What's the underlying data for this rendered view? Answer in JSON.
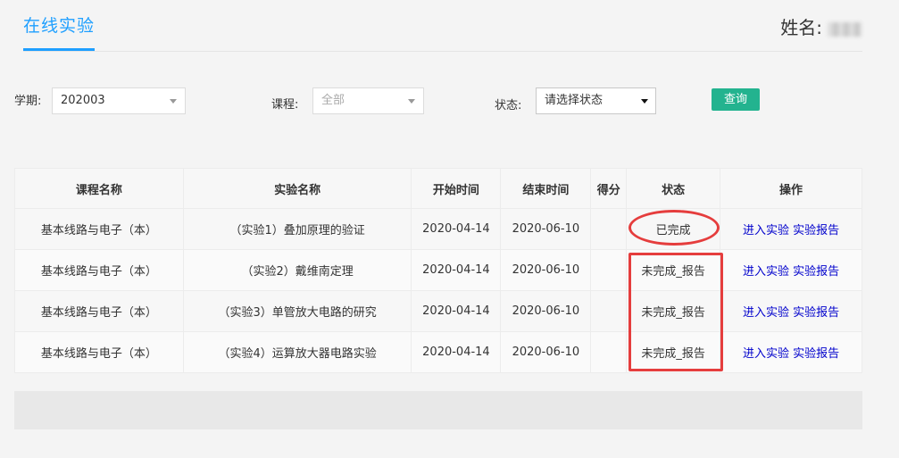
{
  "header": {
    "tab_label": "在线实验",
    "user_label": "姓名:"
  },
  "filters": {
    "term_label": "学期:",
    "term_value": "202003",
    "course_label": "课程:",
    "course_value": "全部",
    "status_label": "状态:",
    "status_value": "请选择状态",
    "query_button": "查询"
  },
  "table": {
    "headers": [
      "课程名称",
      "实验名称",
      "开始时间",
      "结束时间",
      "得分",
      "状态",
      "操作"
    ],
    "rows": [
      {
        "course": "基本线路与电子（本）",
        "experiment": "（实验1）叠加原理的验证",
        "start": "2020-04-14",
        "end": "2020-06-10",
        "score": "",
        "status": "已完成",
        "action_enter": "进入实验",
        "action_report": "实验报告"
      },
      {
        "course": "基本线路与电子（本）",
        "experiment": "（实验2）戴维南定理",
        "start": "2020-04-14",
        "end": "2020-06-10",
        "score": "",
        "status": "未完成_报告",
        "action_enter": "进入实验",
        "action_report": "实验报告"
      },
      {
        "course": "基本线路与电子（本）",
        "experiment": "（实验3）单管放大电路的研究",
        "start": "2020-04-14",
        "end": "2020-06-10",
        "score": "",
        "status": "未完成_报告",
        "action_enter": "进入实验",
        "action_report": "实验报告"
      },
      {
        "course": "基本线路与电子（本）",
        "experiment": "（实验4）运算放大器电路实验",
        "start": "2020-04-14",
        "end": "2020-06-10",
        "score": "",
        "status": "未完成_报告",
        "action_enter": "进入实验",
        "action_report": "实验报告"
      }
    ]
  },
  "colors": {
    "accent": "#1e9fff",
    "button": "#23b38f",
    "highlight": "#e53d3d",
    "link": "#0000cc"
  }
}
